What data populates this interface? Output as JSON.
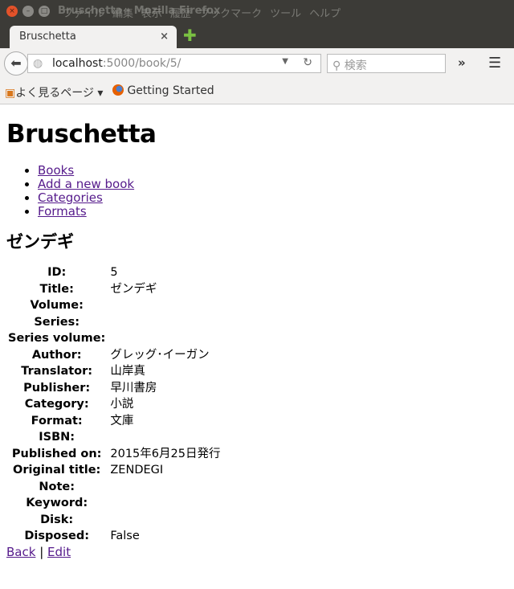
{
  "window": {
    "title": "Bruschetta - Mozilla Firefox",
    "menu": [
      "ファイル",
      "編集",
      "表示",
      "履歴",
      "ブックマーク",
      "ツール",
      "ヘルプ"
    ]
  },
  "tab": {
    "title": "Bruschetta",
    "close": "×",
    "new_tab": "✚"
  },
  "nav": {
    "url_host": "localhost",
    "url_path": ":5000/book/5/",
    "search_placeholder": "検索",
    "overflow": "»"
  },
  "bookmarks": [
    {
      "label": "よく見るページ ▾"
    },
    {
      "label": "Getting Started"
    }
  ],
  "page": {
    "title": "Bruschetta",
    "nav_links": [
      "Books",
      "Add a new book",
      "Categories",
      "Formats"
    ],
    "book_title": "ゼンデギ",
    "fields": [
      {
        "label": "ID:",
        "value": "5"
      },
      {
        "label": "Title:",
        "value": "ゼンデギ"
      },
      {
        "label": "Volume:",
        "value": ""
      },
      {
        "label": "Series:",
        "value": ""
      },
      {
        "label": "Series volume:",
        "value": ""
      },
      {
        "label": "Author:",
        "value": "グレッグ･イーガン"
      },
      {
        "label": "Translator:",
        "value": "山岸真"
      },
      {
        "label": "Publisher:",
        "value": "早川書房"
      },
      {
        "label": "Category:",
        "value": "小説"
      },
      {
        "label": "Format:",
        "value": "文庫"
      },
      {
        "label": "ISBN:",
        "value": ""
      },
      {
        "label": "Published on:",
        "value": "2015年6月25日発行"
      },
      {
        "label": "Original title:",
        "value": "ZENDEGI"
      },
      {
        "label": "Note:",
        "value": ""
      },
      {
        "label": "Keyword:",
        "value": ""
      },
      {
        "label": "Disk:",
        "value": ""
      },
      {
        "label": "Disposed:",
        "value": "False"
      }
    ],
    "back": "Back",
    "sep": "|",
    "edit": "Edit"
  }
}
